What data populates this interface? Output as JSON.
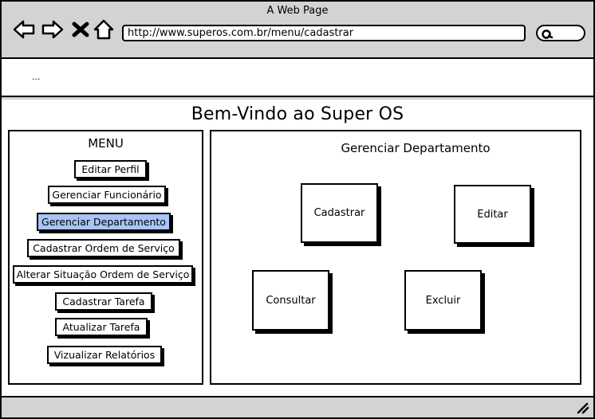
{
  "browser": {
    "window_title": "A Web Page",
    "url": "http://www.superos.com.br/menu/cadastrar",
    "toolbar_text": "..."
  },
  "page": {
    "title": "Bem-Vindo ao Super OS"
  },
  "menu": {
    "title": "MENU",
    "items": [
      {
        "label": "Editar Perfil",
        "selected": false
      },
      {
        "label": "Gerenciar Funcionário",
        "selected": false
      },
      {
        "label": "Gerenciar Departamento",
        "selected": true
      },
      {
        "label": "Cadastrar Ordem de Serviço",
        "selected": false
      },
      {
        "label": "Alterar Situação Ordem de Serviço",
        "selected": false
      },
      {
        "label": "Cadastrar Tarefa",
        "selected": false
      },
      {
        "label": "Atualizar Tarefa",
        "selected": false
      },
      {
        "label": "Vizualizar Relatórios",
        "selected": false
      }
    ]
  },
  "main": {
    "title": "Gerenciar Departamento",
    "actions": {
      "cadastrar": "Cadastrar",
      "editar": "Editar",
      "consultar": "Consultar",
      "excluir": "Excluir"
    }
  },
  "colors": {
    "chrome": "#d3d3d3",
    "selected_item": "#a9c4f5"
  }
}
